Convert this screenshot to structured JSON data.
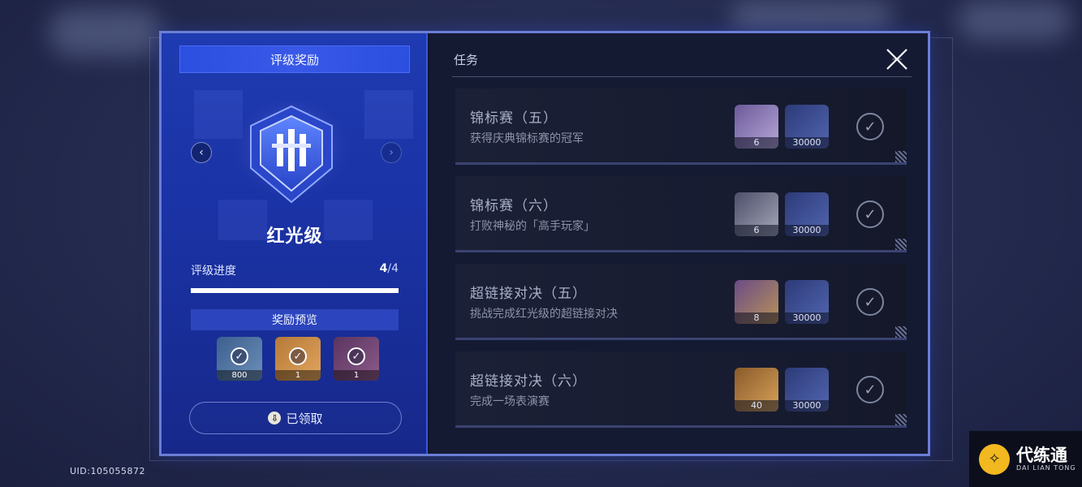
{
  "left_panel": {
    "header": "评级奖励",
    "rank_name": "红光级",
    "progress_label": "评级进度",
    "progress_current": "4",
    "progress_total": "/4",
    "progress_fraction": 1.0,
    "preview_title": "奖励预览",
    "preview_items": [
      {
        "count": "800",
        "icon": "currency-icon"
      },
      {
        "count": "1",
        "icon": "gear-item-icon"
      },
      {
        "count": "1",
        "icon": "card-item-icon"
      }
    ],
    "claimed_label": "已领取",
    "claimed_icon_glyph": "⇩"
  },
  "right_panel": {
    "title": "任务",
    "tasks": [
      {
        "name": "锦标赛（五）",
        "desc": "获得庆典锦标赛的冠军",
        "rewards": [
          {
            "count": "6",
            "icon": "character-card-icon"
          },
          {
            "count": "30000",
            "icon": "coin-stack-icon"
          }
        ]
      },
      {
        "name": "锦标赛（六）",
        "desc": "打败神秘的「高手玩家」",
        "rewards": [
          {
            "count": "6",
            "icon": "character-card-icon"
          },
          {
            "count": "30000",
            "icon": "coin-stack-icon"
          }
        ]
      },
      {
        "name": "超链接对决（五）",
        "desc": "挑战完成红光级的超链接对决",
        "rewards": [
          {
            "count": "8",
            "icon": "scroll-icon"
          },
          {
            "count": "30000",
            "icon": "coin-stack-icon"
          }
        ]
      },
      {
        "name": "超链接对决（六）",
        "desc": "完成一场表演赛",
        "rewards": [
          {
            "count": "40",
            "icon": "book-icon"
          },
          {
            "count": "30000",
            "icon": "coin-stack-icon"
          }
        ]
      }
    ]
  },
  "footer": {
    "uid": "UID:105055872"
  },
  "watermark": {
    "title": "代练通",
    "subtitle": "DAI LIAN TONG",
    "logo_glyph": "✧"
  },
  "colors": {
    "accent": "#2b4fe0",
    "panel_left": "#1f3bb1",
    "panel_right": "#151a33",
    "frame": "#6b7ed6"
  }
}
